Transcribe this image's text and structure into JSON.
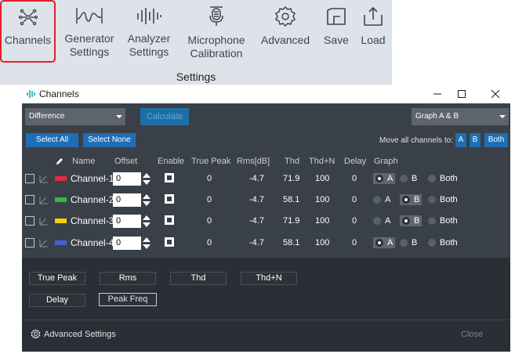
{
  "ribbon": {
    "buttons": [
      {
        "label": "Channels",
        "icon": "channels-icon",
        "selected": true
      },
      {
        "label": "Generator\nSettings",
        "icon": "generator-wave-icon",
        "selected": false
      },
      {
        "label": "Analyzer\nSettings",
        "icon": "analyzer-bars-icon",
        "selected": false
      },
      {
        "label": "Microphone\nCalibration",
        "icon": "microphone-icon",
        "selected": false
      },
      {
        "label": "Advanced",
        "icon": "gear-icon",
        "selected": false
      },
      {
        "label": "Save",
        "icon": "save-icon",
        "selected": false
      },
      {
        "label": "Load",
        "icon": "upload-icon",
        "selected": false
      }
    ],
    "group_label": "Settings",
    "highlight_color": "#e0202a"
  },
  "dialog": {
    "title": "Channels",
    "mode_select": "Difference",
    "calculate_label": "Calculate",
    "graph_select": "Graph A & B",
    "select_all_label": "Select All",
    "select_none_label": "Select None",
    "move_all_label": "Move all channels to:",
    "move_a_label": "A",
    "move_b_label": "B",
    "move_both_label": "Both",
    "columns": [
      "Name",
      "Offset",
      "Enable",
      "True Peak",
      "Rms[dB]",
      "Thd",
      "Thd+N",
      "Delay",
      "Graph"
    ],
    "channels": [
      {
        "name": "Channel-1",
        "color": "#e8263f",
        "offset": "0",
        "enabled": true,
        "true_peak": "0",
        "rms": "-4.7",
        "thd": "71.9",
        "thdn": "100",
        "delay": "0",
        "graph": "A"
      },
      {
        "name": "Channel-2",
        "color": "#2ebd3c",
        "offset": "0",
        "enabled": true,
        "true_peak": "0",
        "rms": "-4.7",
        "thd": "58.1",
        "thdn": "100",
        "delay": "0",
        "graph": "B"
      },
      {
        "name": "Channel-3",
        "color": "#f5d400",
        "offset": "0",
        "enabled": true,
        "true_peak": "0",
        "rms": "-4.7",
        "thd": "71.9",
        "thdn": "100",
        "delay": "0",
        "graph": "B"
      },
      {
        "name": "Channel-4",
        "color": "#3e5fd9",
        "offset": "0",
        "enabled": true,
        "true_peak": "0",
        "rms": "-4.7",
        "thd": "58.1",
        "thdn": "100",
        "delay": "0",
        "graph": "A"
      }
    ],
    "graph_options": [
      "A",
      "B",
      "Both"
    ],
    "metric_buttons": [
      {
        "label": "True Peak",
        "active": false
      },
      {
        "label": "Rms",
        "active": false
      },
      {
        "label": "Thd",
        "active": false
      },
      {
        "label": "Thd+N",
        "active": false
      },
      {
        "label": "Delay",
        "active": false
      },
      {
        "label": "Peak Freq",
        "active": true
      }
    ],
    "advanced_settings_label": "Advanced Settings",
    "close_label": "Close"
  }
}
